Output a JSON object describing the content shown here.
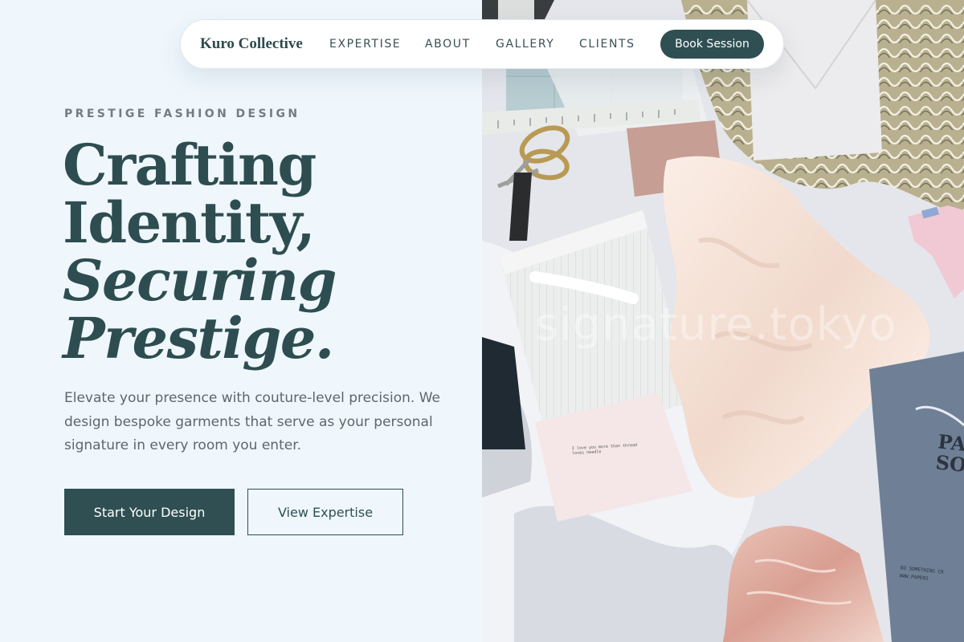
{
  "nav": {
    "brand": "Kuro Collective",
    "links": [
      "EXPERTISE",
      "ABOUT",
      "GALLERY",
      "CLIENTS"
    ],
    "cta": "Book Session"
  },
  "hero": {
    "eyebrow": "PRESTIGE FASHION DESIGN",
    "headline": [
      "Crafting",
      "Identity,",
      "Securing",
      "Prestige."
    ],
    "description": "Elevate your presence with couture-level precision. We design bespoke garments that serve as your personal signature in every room you enter.",
    "primary_button": "Start Your Design",
    "secondary_button": "View Expertise"
  },
  "image": {
    "watermark": "signature.tokyo",
    "card_text": "I love you more than thread\nloves needle",
    "brand_print": "PAPER\nSOU",
    "brand_fine": "DO SOMETHING CR\nWWW.PAPERS"
  },
  "colors": {
    "accent": "#2f4f52",
    "page_background": "#eff7fd",
    "text_muted": "#5c676b"
  }
}
